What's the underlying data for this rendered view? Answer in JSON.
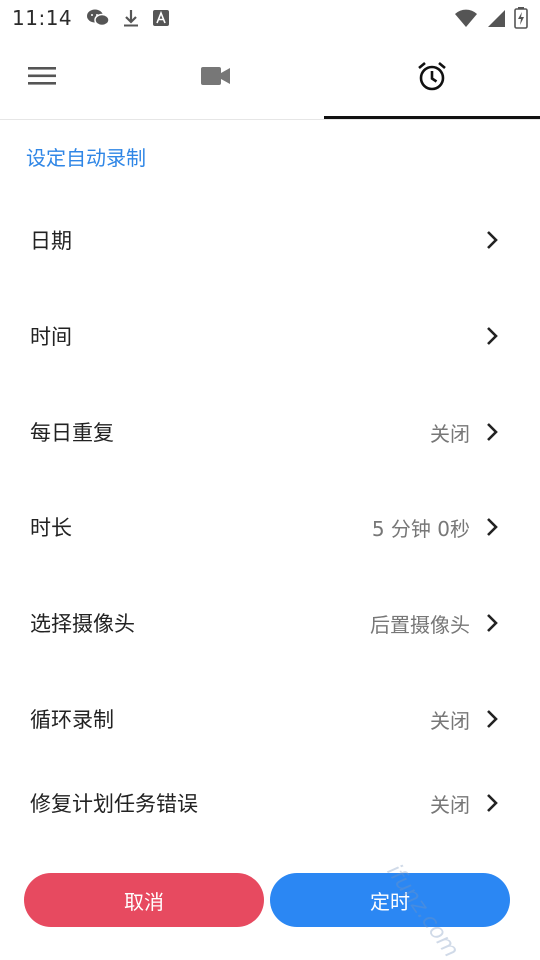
{
  "status_bar": {
    "time": "11:14",
    "left_icons": [
      "wechat-icon",
      "download-icon",
      "text-a-icon"
    ],
    "right_icons": [
      "wifi-icon",
      "signal-icon",
      "battery-charging-icon"
    ]
  },
  "tabs": [
    {
      "icon": "menu-icon",
      "active": false
    },
    {
      "icon": "video-camera-icon",
      "active": false
    },
    {
      "icon": "alarm-clock-icon",
      "active": true
    }
  ],
  "section_title": "设定自动录制",
  "rows": [
    {
      "label": "日期",
      "value": ""
    },
    {
      "label": "时间",
      "value": ""
    },
    {
      "label": "每日重复",
      "value": "关闭"
    },
    {
      "label": "时长",
      "value": "5 分钟 0秒"
    },
    {
      "label": "选择摄像头",
      "value": "后置摄像头"
    },
    {
      "label": "循环录制",
      "value": "关闭"
    },
    {
      "label": "修复计划任务错误",
      "value": "关闭"
    }
  ],
  "buttons": {
    "cancel": "取消",
    "timer": "定时"
  },
  "watermark": "ifunz.com",
  "colors": {
    "accent_blue": "#2f86e6",
    "cancel_red": "#e74a60",
    "timer_blue": "#2b87f3",
    "tab_indicator": "#111111"
  }
}
